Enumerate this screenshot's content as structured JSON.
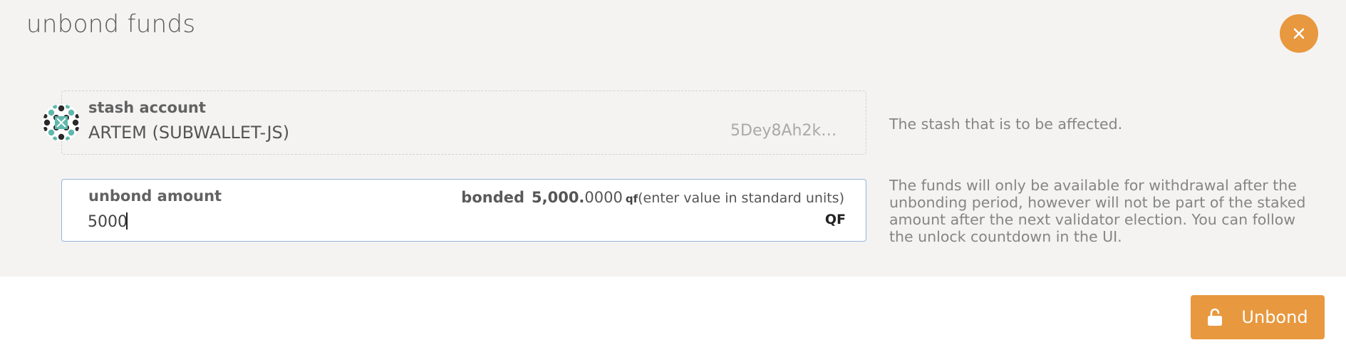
{
  "modal": {
    "title": "unbond funds",
    "close_icon": "close-icon"
  },
  "stash": {
    "label": "stash account",
    "name": "ARTEM (SUBWALLET-JS)",
    "address": "5Dey8Ah2k…",
    "help": "The stash that is to be affected.",
    "avatar_icon": "identicon"
  },
  "amount": {
    "label": "unbond amount",
    "bonded_label": "bonded",
    "bonded_integer": "5,000.",
    "bonded_decimal": "0000",
    "bonded_unit": "qf",
    "hint": "(enter value in standard units)",
    "value": "5000",
    "unit": "QF",
    "help": "The funds will only be available for withdrawal after the unbonding period, however will not be part of the staked amount after the next validator election. You can follow the unlock countdown in the UI."
  },
  "footer": {
    "unbond_label": "Unbond",
    "unbond_icon": "unlock-icon"
  },
  "colors": {
    "accent": "#e8983e",
    "panel_bg": "#f4f3f2",
    "input_border": "#94b5d6"
  }
}
